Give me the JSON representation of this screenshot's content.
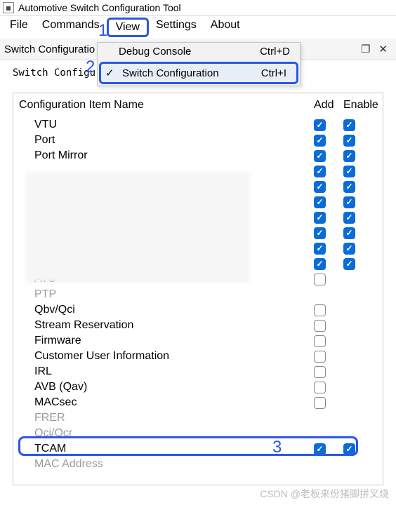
{
  "title": "Automotive Switch Configuration Tool",
  "menubar": [
    "File",
    "Commands",
    "View",
    "Settings",
    "About"
  ],
  "dropdown": {
    "items": [
      {
        "check": false,
        "label": "Debug Console",
        "shortcut": "Ctrl+D"
      },
      {
        "check": true,
        "label": "Switch Configuration",
        "shortcut": "Ctrl+I"
      }
    ]
  },
  "subtoolbar": {
    "tab": "Switch Configuratio"
  },
  "group_label": "Switch Configura",
  "columns": {
    "name": "Configuration Item Name",
    "add": "Add",
    "enable": "Enable"
  },
  "rows": [
    {
      "name": "VTU",
      "add": "on",
      "enable": "on"
    },
    {
      "name": "Port",
      "add": "on",
      "enable": "on"
    },
    {
      "name": "Port Mirror",
      "add": "on",
      "enable": "on"
    },
    {
      "name": "",
      "add": "on",
      "enable": "on"
    },
    {
      "name": "",
      "add": "on",
      "enable": "on"
    },
    {
      "name": "",
      "add": "on",
      "enable": "on"
    },
    {
      "name": "",
      "add": "on",
      "enable": "on"
    },
    {
      "name": "",
      "add": "on",
      "enable": "on"
    },
    {
      "name": "",
      "add": "on",
      "enable": "on"
    },
    {
      "name": "",
      "add": "on",
      "enable": "on"
    },
    {
      "name": "ATU",
      "add": "off",
      "enable": "none"
    },
    {
      "name": "PTP",
      "disabled": true,
      "add": "none",
      "enable": "none"
    },
    {
      "name": "Qbv/Qci",
      "add": "off",
      "enable": "none"
    },
    {
      "name": "Stream Reservation",
      "add": "off",
      "enable": "none"
    },
    {
      "name": "Firmware",
      "add": "off",
      "enable": "none"
    },
    {
      "name": "Customer User Information",
      "add": "off",
      "enable": "none"
    },
    {
      "name": "IRL",
      "add": "off",
      "enable": "none"
    },
    {
      "name": "AVB (Qav)",
      "add": "off",
      "enable": "none"
    },
    {
      "name": "MACsec",
      "add": "off",
      "enable": "none"
    },
    {
      "name": "FRER",
      "disabled": true,
      "add": "none",
      "enable": "none"
    },
    {
      "name": "Qci/Qcr",
      "disabled": true,
      "add": "none",
      "enable": "none"
    },
    {
      "name": "TCAM",
      "add": "on",
      "enable": "on"
    },
    {
      "name": "MAC Address",
      "disabled": true,
      "add": "none",
      "enable": "none"
    }
  ],
  "callouts": {
    "c1": "1",
    "c2": "2",
    "c3": "3"
  },
  "watermark": "CSDN @老板来份猪脚拼叉烧"
}
